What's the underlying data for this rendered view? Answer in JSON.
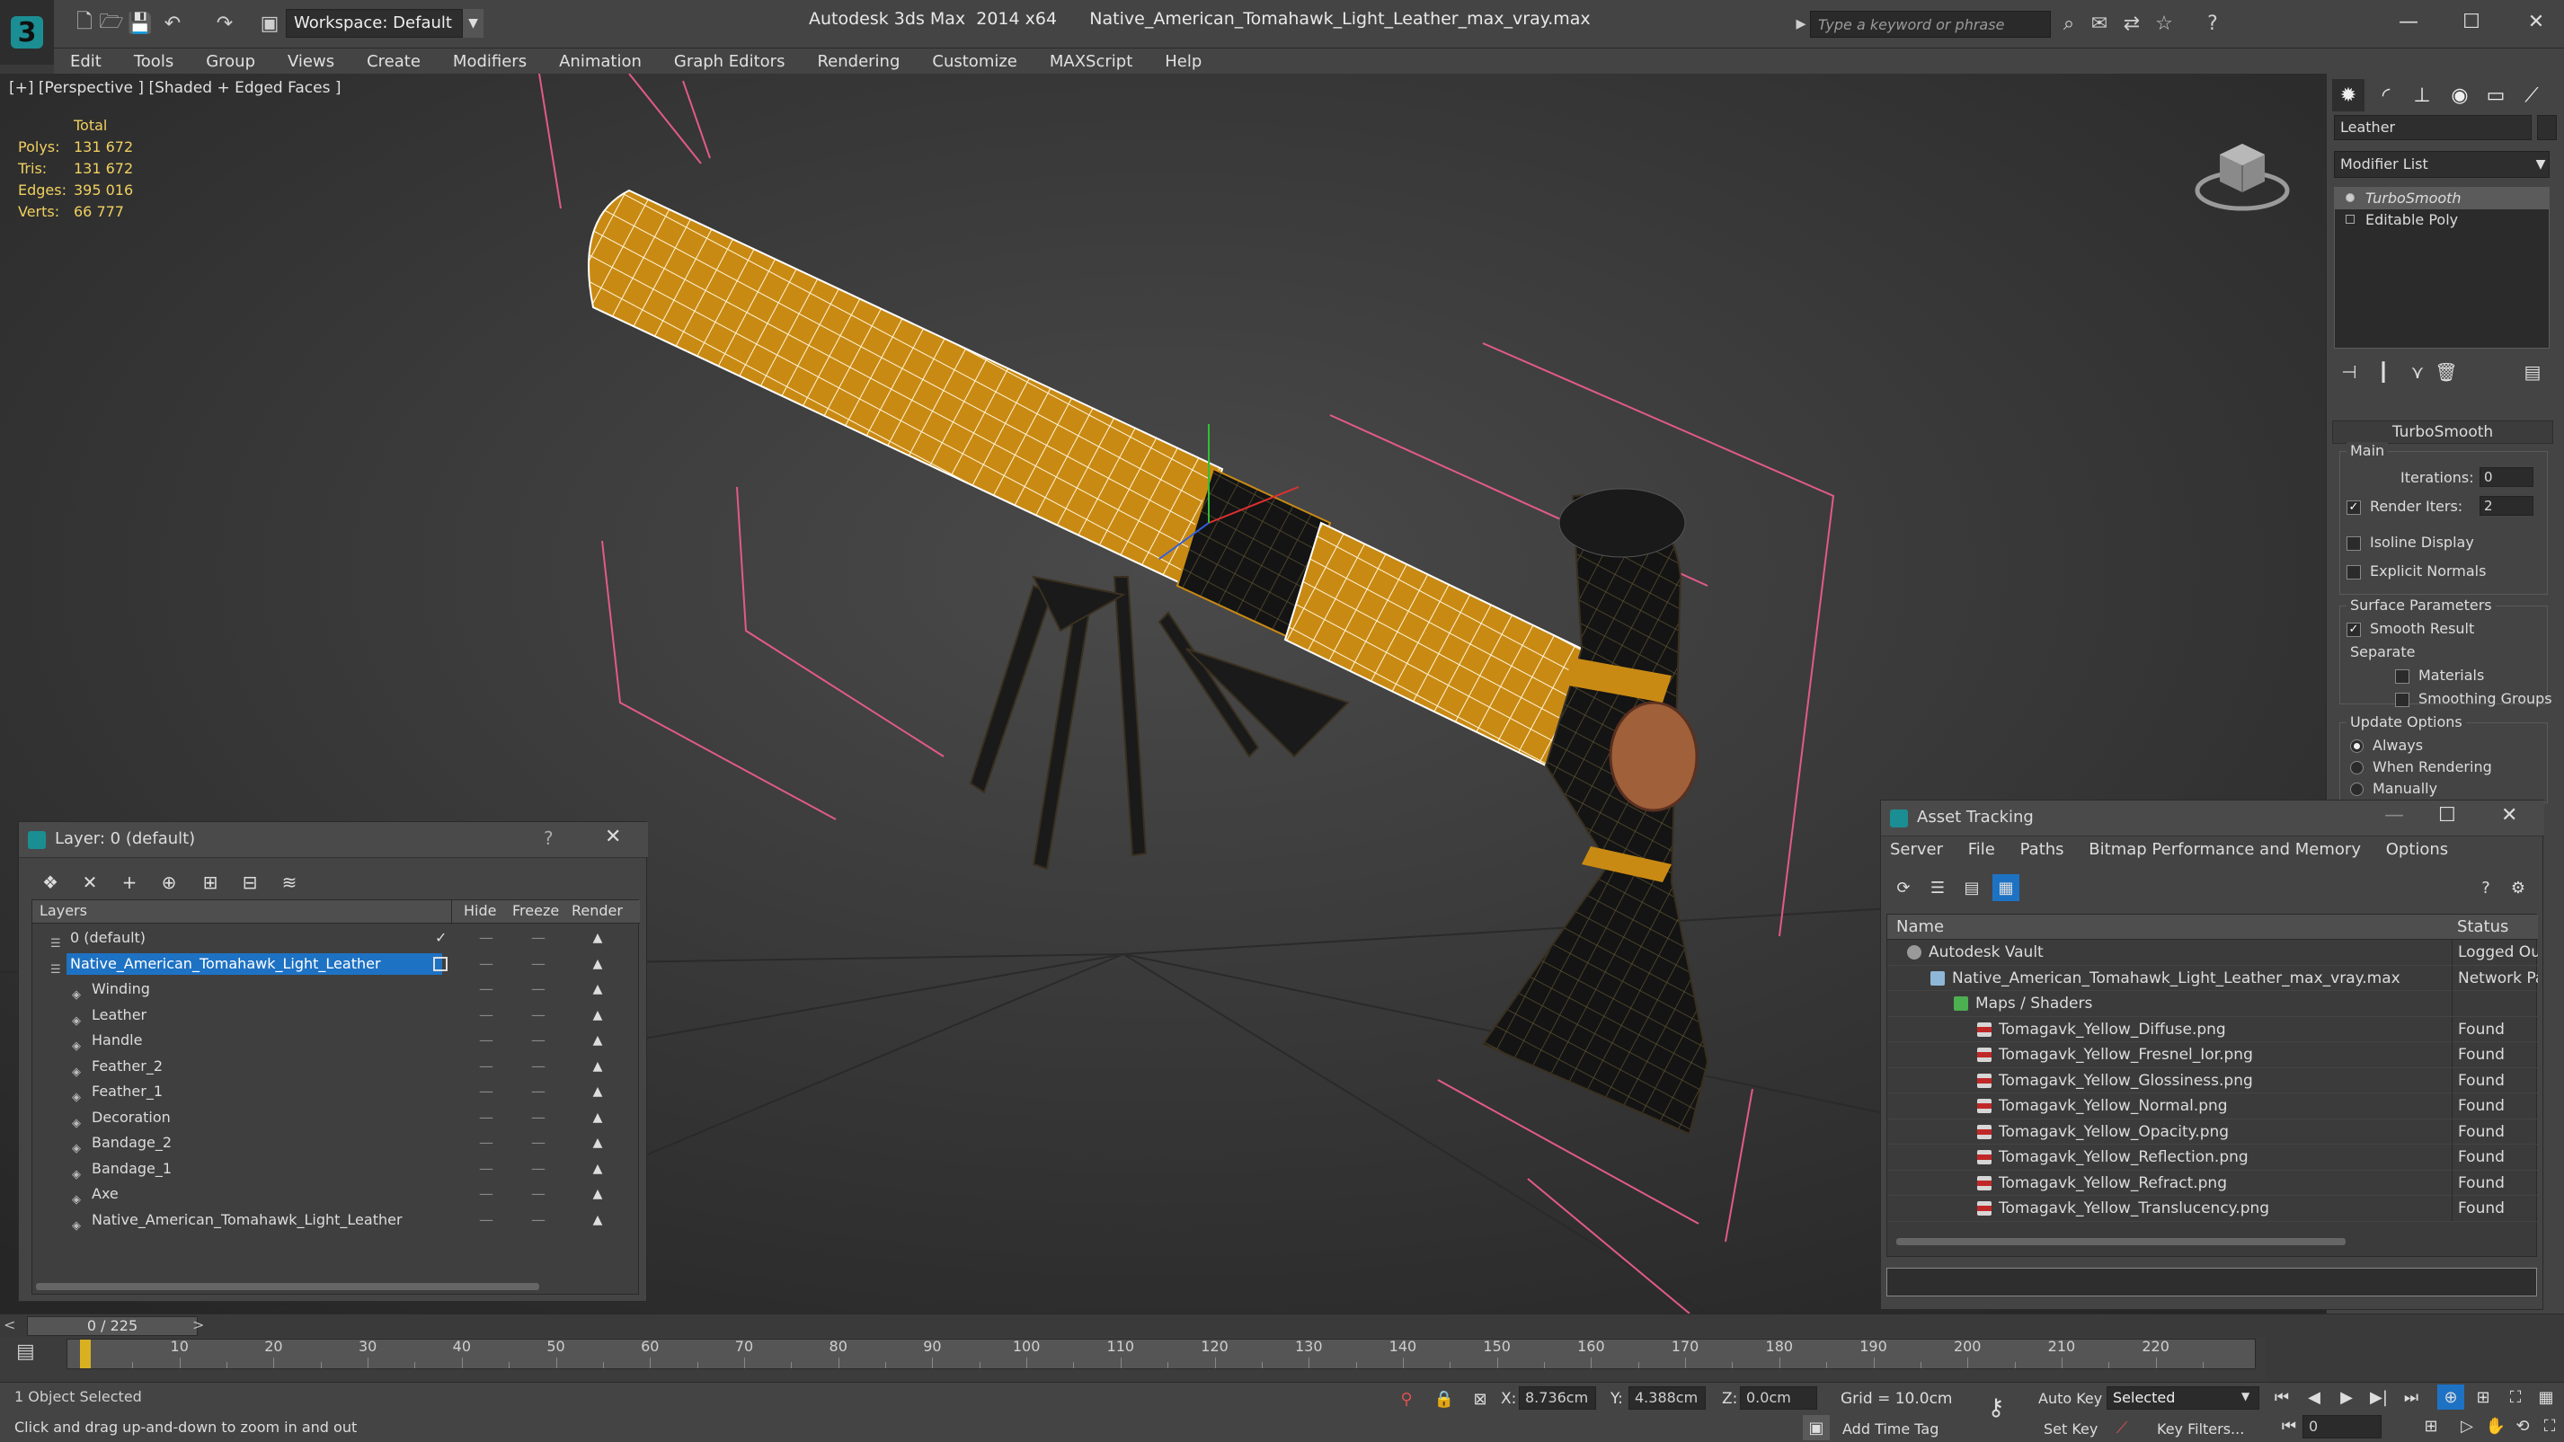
{
  "app": {
    "window_title": "Autodesk 3ds Max  2014 x64      Native_American_Tomahawk_Light_Leather_max_vray.max",
    "workspace": "Workspace: Default",
    "search_placeholder": "Type a keyword or phrase"
  },
  "menu": [
    "Edit",
    "Tools",
    "Group",
    "Views",
    "Create",
    "Modifiers",
    "Animation",
    "Graph Editors",
    "Rendering",
    "Customize",
    "MAXScript",
    "Help"
  ],
  "viewport": {
    "label": "[+] [Perspective ] [Shaded + Edged Faces ]",
    "stats": {
      "header": "Total",
      "rows": [
        {
          "k": "Polys:",
          "v": "131 672"
        },
        {
          "k": "Tris:",
          "v": "131 672"
        },
        {
          "k": "Edges:",
          "v": "395 016"
        },
        {
          "k": "Verts:",
          "v": "66 777"
        }
      ]
    }
  },
  "command_panel": {
    "object_name": "Leather",
    "modifier_list": "Modifier List",
    "stack": [
      "TurboSmooth",
      "Editable Poly"
    ],
    "rollout_title": "TurboSmooth",
    "main_group": "Main",
    "iterations_label": "Iterations:",
    "iterations_value": "0",
    "render_iters_label": "Render Iters:",
    "render_iters_value": "2",
    "isoline": "Isoline Display",
    "explicit_normals": "Explicit Normals",
    "surface_group": "Surface Parameters",
    "smooth_result": "Smooth Result",
    "separate": "Separate",
    "materials": "Materials",
    "smoothing_groups": "Smoothing Groups",
    "update_group": "Update Options",
    "always": "Always",
    "when_rendering": "When Rendering",
    "manually": "Manually"
  },
  "layer_window": {
    "title": "Layer: 0 (default)",
    "columns": {
      "layers": "Layers",
      "hide": "Hide",
      "freeze": "Freeze",
      "render": "Render"
    },
    "rows": [
      {
        "name": "0 (default)",
        "level": 0
      },
      {
        "name": "Native_American_Tomahawk_Light_Leather",
        "level": 0
      },
      {
        "name": "Winding",
        "level": 1
      },
      {
        "name": "Leather",
        "level": 1
      },
      {
        "name": "Handle",
        "level": 1
      },
      {
        "name": "Feather_2",
        "level": 1
      },
      {
        "name": "Feather_1",
        "level": 1
      },
      {
        "name": "Decoration",
        "level": 1
      },
      {
        "name": "Bandage_2",
        "level": 1
      },
      {
        "name": "Bandage_1",
        "level": 1
      },
      {
        "name": "Axe",
        "level": 1
      },
      {
        "name": "Native_American_Tomahawk_Light_Leather",
        "level": 1
      }
    ]
  },
  "asset_tracking": {
    "title": "Asset Tracking",
    "menu": [
      "Server",
      "File",
      "Paths",
      "Bitmap Performance and Memory",
      "Options"
    ],
    "columns": {
      "name": "Name",
      "status": "Status"
    },
    "rows": [
      {
        "name": "Autodesk Vault",
        "status": "Logged Out",
        "level": 0,
        "icon": "vault"
      },
      {
        "name": "Native_American_Tomahawk_Light_Leather_max_vray.max",
        "status": "Network Path",
        "level": 1,
        "icon": "max"
      },
      {
        "name": "Maps / Shaders",
        "status": "",
        "level": 2,
        "icon": "folder"
      },
      {
        "name": "Tomagavk_Yellow_Diffuse.png",
        "status": "Found",
        "level": 3,
        "icon": "png"
      },
      {
        "name": "Tomagavk_Yellow_Fresnel_Ior.png",
        "status": "Found",
        "level": 3,
        "icon": "png"
      },
      {
        "name": "Tomagavk_Yellow_Glossiness.png",
        "status": "Found",
        "level": 3,
        "icon": "png"
      },
      {
        "name": "Tomagavk_Yellow_Normal.png",
        "status": "Found",
        "level": 3,
        "icon": "png"
      },
      {
        "name": "Tomagavk_Yellow_Opacity.png",
        "status": "Found",
        "level": 3,
        "icon": "png"
      },
      {
        "name": "Tomagavk_Yellow_Reflection.png",
        "status": "Found",
        "level": 3,
        "icon": "png"
      },
      {
        "name": "Tomagavk_Yellow_Refract.png",
        "status": "Found",
        "level": 3,
        "icon": "png"
      },
      {
        "name": "Tomagavk_Yellow_Translucency.png",
        "status": "Found",
        "level": 3,
        "icon": "png"
      }
    ]
  },
  "timeline": {
    "slider": "0 / 225",
    "ticks": [
      "0",
      "10",
      "20",
      "30",
      "40",
      "50",
      "60",
      "70",
      "80",
      "90",
      "100",
      "110",
      "120",
      "130",
      "140",
      "150",
      "160",
      "170",
      "180",
      "190",
      "200",
      "210",
      "220"
    ]
  },
  "status": {
    "selected": "1 Object Selected",
    "hint": "Click and drag up-and-down to zoom in and out",
    "x_label": "X:",
    "x": "8.736cm",
    "y_label": "Y:",
    "y": "4.388cm",
    "z_label": "Z:",
    "z": "0.0cm",
    "grid": "Grid = 10.0cm",
    "add_time_tag": "Add Time Tag",
    "auto_key": "Auto Key",
    "set_key": "Set Key",
    "selected_dropdown": "Selected",
    "key_filters": "Key Filters...",
    "frame": "0"
  },
  "colors": {
    "selection": "#1e72c4",
    "stats": "#f0d060",
    "wire": "#ffffff",
    "leather": "#c98a14"
  }
}
